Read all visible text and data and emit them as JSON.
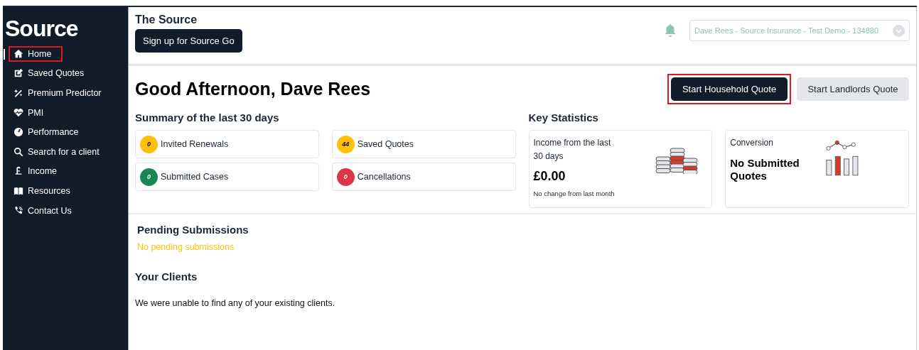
{
  "sidebar": {
    "logo": "Source",
    "items": [
      {
        "label": "Home",
        "selected": true,
        "highlighted": true
      },
      {
        "label": "Saved Quotes",
        "selected": false,
        "highlighted": false
      },
      {
        "label": "Premium Predictor",
        "selected": false,
        "highlighted": false
      },
      {
        "label": "PMI",
        "selected": false,
        "highlighted": false
      },
      {
        "label": "Performance",
        "selected": false,
        "highlighted": false
      },
      {
        "label": "Search for a client",
        "selected": false,
        "highlighted": false
      },
      {
        "label": "Income",
        "selected": false,
        "highlighted": false
      },
      {
        "label": "Resources",
        "selected": false,
        "highlighted": false
      },
      {
        "label": "Contact Us",
        "selected": false,
        "highlighted": false
      }
    ]
  },
  "header": {
    "title": "The Source",
    "signup_button": "Sign up for Source Go",
    "account_select": "Dave Rees - Source Insurance - Test Demo - 134880"
  },
  "greeting": "Good Afternoon, Dave Rees",
  "actions": [
    {
      "label": "Start Household Quote",
      "kind": "primary",
      "highlighted": true
    },
    {
      "label": "Start Landlords Quote",
      "kind": "secondary",
      "highlighted": false
    }
  ],
  "summary": {
    "title": "Summary of the last 30 days",
    "items": [
      {
        "count": "0",
        "label": "Invited Renewals",
        "color": "#ffc107"
      },
      {
        "count": "44",
        "label": "Saved Quotes",
        "color": "#ffc107"
      },
      {
        "count": "0",
        "label": "Submitted Cases",
        "color": "#198754"
      },
      {
        "count": "0",
        "label": "Cancellations",
        "color": "#dc3545"
      }
    ]
  },
  "key_statistics": {
    "title": "Key Statistics",
    "cards": [
      {
        "kind": "coins",
        "label": "Income from the last 30 days",
        "value": "£0.00",
        "note": "No change from last month"
      },
      {
        "kind": "chart",
        "label": "Conversion",
        "value": "No Submitted Quotes"
      }
    ]
  },
  "pending": {
    "title": "Pending Submissions",
    "empty": "No pending submissions"
  },
  "clients": {
    "title": "Your Clients",
    "empty": "We were unable to find any of your existing clients."
  }
}
